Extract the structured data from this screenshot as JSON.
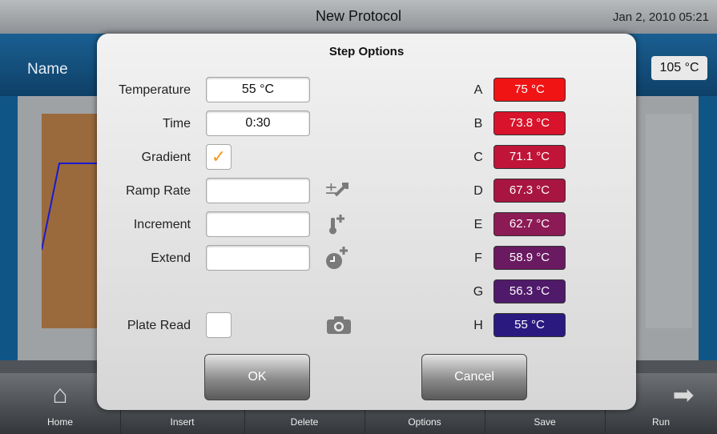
{
  "app": {
    "title": "New Protocol",
    "datetime": "Jan 2, 2010 05:21",
    "name_label": "Name",
    "lid_temp": "105 °C"
  },
  "nav": [
    {
      "label": "Home",
      "icon": "home-icon"
    },
    {
      "label": "Insert",
      "icon": "insert-icon"
    },
    {
      "label": "Delete",
      "icon": "delete-icon"
    },
    {
      "label": "Options",
      "icon": "options-icon"
    },
    {
      "label": "Save",
      "icon": "save-icon"
    },
    {
      "label": "Run",
      "icon": "run-icon"
    }
  ],
  "dialog": {
    "title": "Step Options",
    "fields": {
      "temperature": {
        "label": "Temperature",
        "value": "55 °C"
      },
      "time": {
        "label": "Time",
        "value": "0:30"
      },
      "gradient": {
        "label": "Gradient",
        "checked": true,
        "mark": "✓"
      },
      "ramp_rate": {
        "label": "Ramp Rate",
        "value": "",
        "icon": "ramp-rate-icon"
      },
      "increment": {
        "label": "Increment",
        "value": "",
        "icon": "thermometer-plus-icon"
      },
      "extend": {
        "label": "Extend",
        "value": "",
        "icon": "clock-plus-icon"
      },
      "plate_read": {
        "label": "Plate Read",
        "checked": false,
        "icon": "camera-icon"
      }
    },
    "gradient_rows": [
      {
        "row": "A",
        "temp": "75 °C",
        "color": "#f01414"
      },
      {
        "row": "B",
        "temp": "73.8 °C",
        "color": "#d8132b"
      },
      {
        "row": "C",
        "temp": "71.1 °C",
        "color": "#c01538"
      },
      {
        "row": "D",
        "temp": "67.3 °C",
        "color": "#a81540"
      },
      {
        "row": "E",
        "temp": "62.7 °C",
        "color": "#8c1a55"
      },
      {
        "row": "F",
        "temp": "58.9 °C",
        "color": "#6a1a60"
      },
      {
        "row": "G",
        "temp": "56.3 °C",
        "color": "#501a6a"
      },
      {
        "row": "H",
        "temp": "55 °C",
        "color": "#2a1a80"
      }
    ],
    "ok_label": "OK",
    "cancel_label": "Cancel"
  }
}
